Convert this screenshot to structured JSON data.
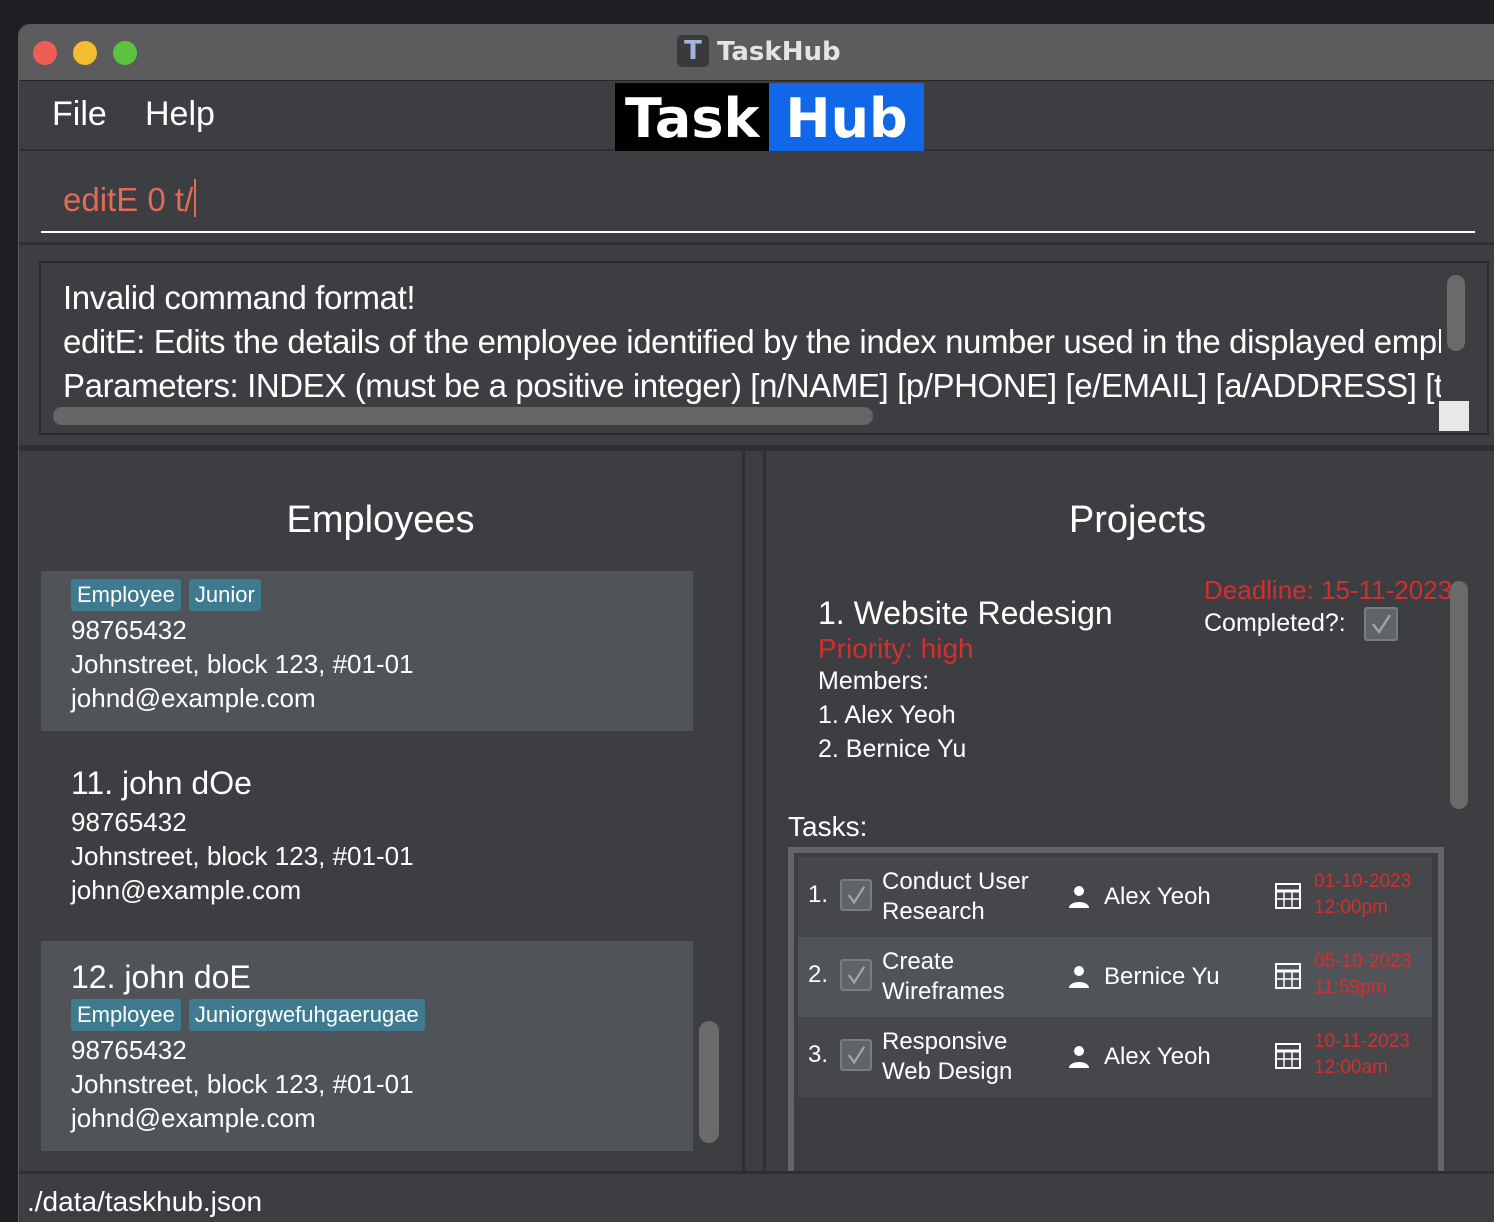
{
  "window": {
    "title": "TaskHub",
    "app_icon_letter": "T"
  },
  "menu": {
    "file": "File",
    "help": "Help"
  },
  "logo": {
    "task": "Task",
    "hub": "Hub"
  },
  "command": {
    "value": "editE 0 t/"
  },
  "result": {
    "line1": "Invalid command format!",
    "line2": "editE: Edits the details of the employee identified by the index number used in the displayed employee list.",
    "line3": "Parameters: INDEX (must be a positive integer) [n/NAME] [p/PHONE] [e/EMAIL] [a/ADDRESS] [t/TAG]..."
  },
  "employees": {
    "title": "Employees",
    "items": [
      {
        "name": "",
        "tags": [
          "Employee",
          "Junior"
        ],
        "phone": "98765432",
        "address": "Johnstreet, block 123, #01-01",
        "email": "johnd@example.com"
      },
      {
        "name": "11.  john dOe",
        "tags": [],
        "phone": "98765432",
        "address": "Johnstreet, block 123, #01-01",
        "email": "john@example.com"
      },
      {
        "name": "12.  john doE",
        "tags": [
          "Employee",
          "Juniorgwefuhgaerugae"
        ],
        "phone": "98765432",
        "address": "Johnstreet, block 123, #01-01",
        "email": "johnd@example.com"
      }
    ]
  },
  "projects": {
    "title": "Projects",
    "items": [
      {
        "name": "1.  Website Redesign",
        "priority": "Priority: high",
        "members_label": "Members:",
        "members": [
          "1. Alex Yeoh",
          "2. Bernice Yu"
        ],
        "deadline": "Deadline: 15-11-2023",
        "completed_label": "Completed?:",
        "completed": true,
        "tasks_label": "Tasks:",
        "tasks": [
          {
            "num": "1.",
            "name": "Conduct User Research",
            "assignee": "Alex Yeoh",
            "due_date": "01-10-2023",
            "due_time": "12:00pm",
            "done": true
          },
          {
            "num": "2.",
            "name": "Create Wireframes",
            "assignee": "Bernice Yu",
            "due_date": "05-10-2023",
            "due_time": "11:59pm",
            "done": true
          },
          {
            "num": "3.",
            "name": "Responsive Web Design",
            "assignee": "Alex Yeoh",
            "due_date": "10-11-2023",
            "due_time": "12:00am",
            "done": true
          }
        ]
      }
    ]
  },
  "status": {
    "path": "./data/taskhub.json"
  },
  "colors": {
    "accent_blue": "#1068e8",
    "error_red": "#d32f2f",
    "command_text": "#e36b55",
    "tag_bg": "#3e7b91"
  },
  "icons": {
    "close": "red-circle",
    "minimize": "yellow-circle",
    "maximize": "green-circle",
    "task_check": "checkmark-icon",
    "assignee": "person-icon",
    "deadline": "calendar-icon"
  }
}
